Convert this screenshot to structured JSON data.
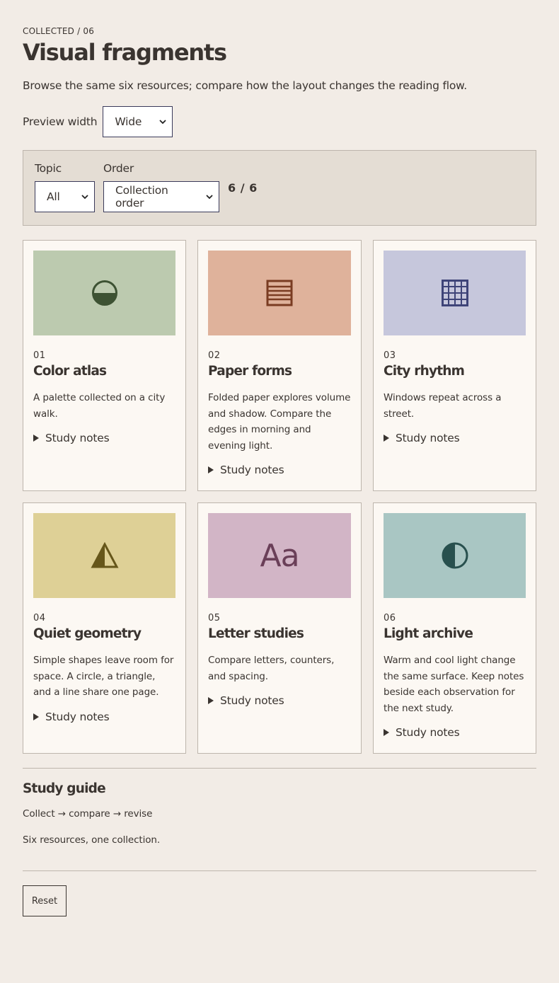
{
  "header": {
    "eyebrow": "COLLECTED / 06",
    "title": "Visual fragments",
    "subtitle": "Browse the same six resources; compare how the layout changes the reading flow."
  },
  "preview": {
    "label": "Preview width",
    "selected": "Wide"
  },
  "filters": {
    "topic_label": "Topic",
    "topic_selected": "All",
    "order_label": "Order",
    "order_selected": "Collection order",
    "count": "6 / 6"
  },
  "cards": [
    {
      "num": "01",
      "title": "Color atlas",
      "desc": "A palette collected on a city walk.",
      "notes": "Study notes",
      "color": "#bccaaf",
      "icon_color": "#3d5233",
      "icon": "half-circle-icon"
    },
    {
      "num": "02",
      "title": "Paper forms",
      "desc": "Folded paper explores volume and shadow. Compare the edges in morning and evening light.",
      "notes": "Study notes",
      "color": "#dfb29b",
      "icon_color": "#7a3c22",
      "icon": "striped-square-icon"
    },
    {
      "num": "03",
      "title": "City rhythm",
      "desc": "Windows repeat across a street.",
      "notes": "Study notes",
      "color": "#c6c7dc",
      "icon_color": "#3e4478",
      "icon": "window-grid-icon"
    },
    {
      "num": "04",
      "title": "Quiet geometry",
      "desc": "Simple shapes leave room for space. A circle, a triangle, and a line share one page.",
      "notes": "Study notes",
      "color": "#ded096",
      "icon_color": "#66561a",
      "icon": "triangle-icon"
    },
    {
      "num": "05",
      "title": "Letter studies",
      "desc": "Compare letters, counters, and spacing.",
      "notes": "Study notes",
      "color": "#d2b5c6",
      "icon_color": "#6a3f58",
      "icon": "letters-aa-icon",
      "icon_text": "Aa"
    },
    {
      "num": "06",
      "title": "Light archive",
      "desc": "Warm and cool light change the same surface. Keep notes beside each observation for the next study.",
      "notes": "Study notes",
      "color": "#a9c6c3",
      "icon_color": "#28504e",
      "icon": "contrast-circle-icon"
    }
  ],
  "guide": {
    "title": "Study guide",
    "flow": "Collect → compare → revise",
    "summary": "Six resources, one collection."
  },
  "reset_label": "Reset"
}
